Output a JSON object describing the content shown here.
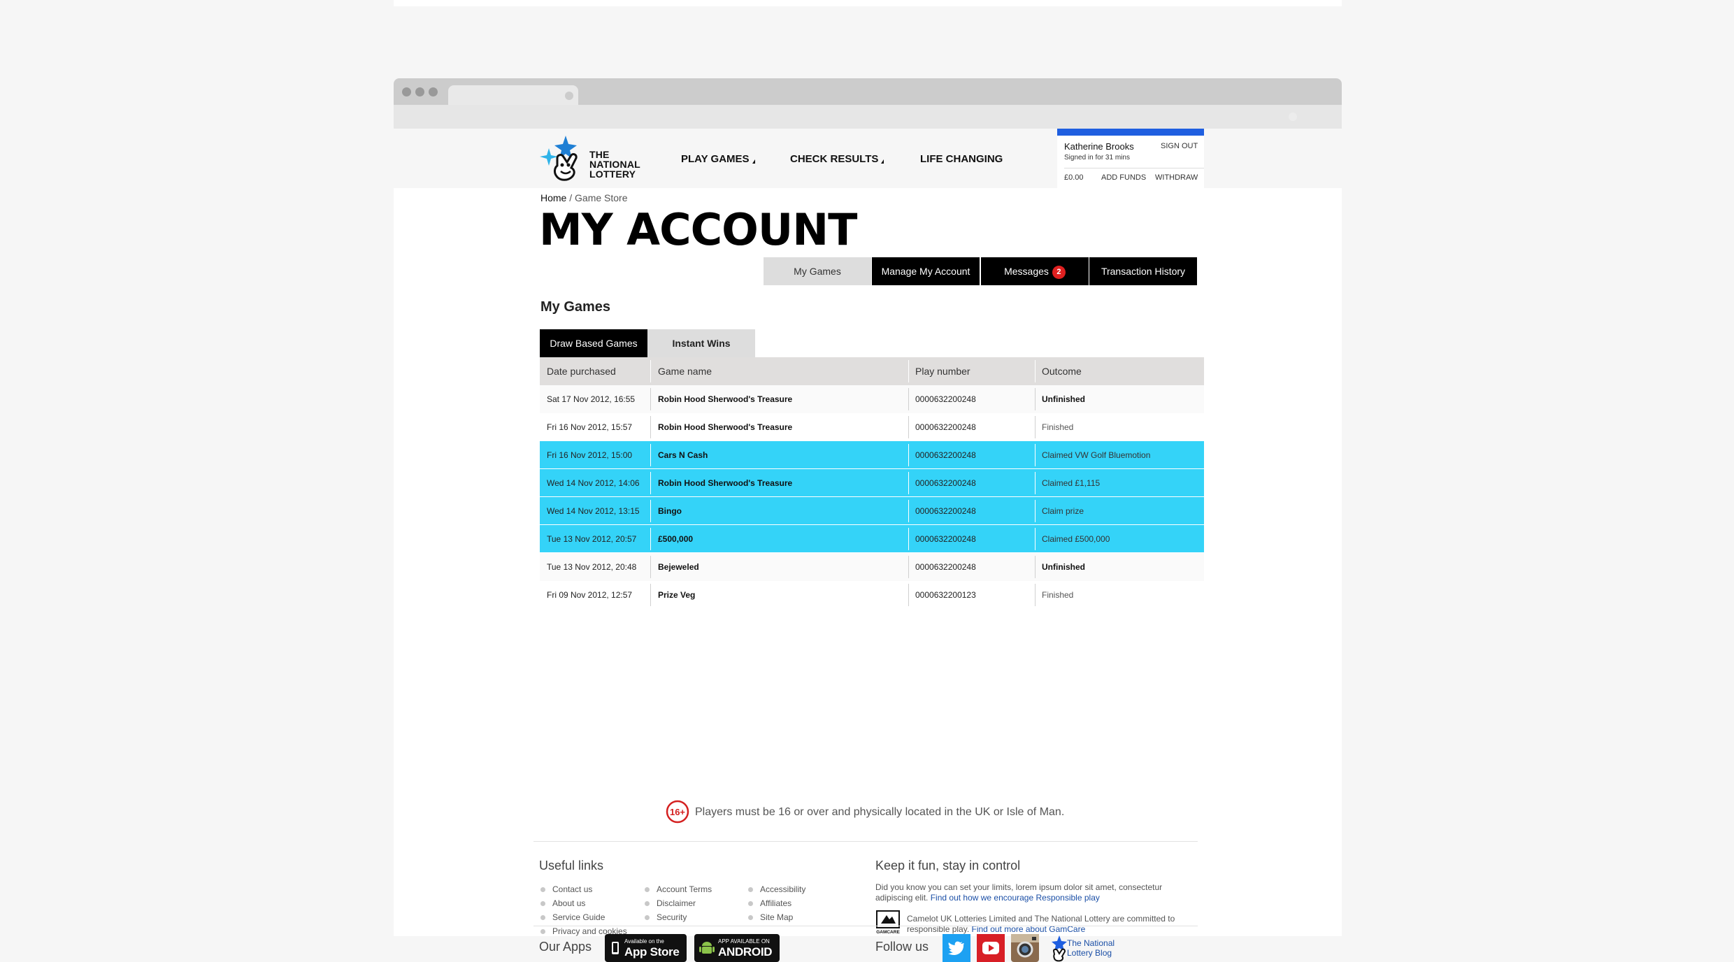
{
  "header": {
    "logo_lines": [
      "THE",
      "NATIONAL",
      "LOTTERY"
    ],
    "nav": [
      {
        "label": "PLAY GAMES",
        "has_caret": true
      },
      {
        "label": "CHECK RESULTS",
        "has_caret": true
      },
      {
        "label": "LIFE CHANGING",
        "has_caret": false
      }
    ],
    "account": {
      "name": "Katherine Brooks",
      "signed_in": "Signed in for 31 mins",
      "sign_out": "SIGN OUT",
      "balance": "£0.00",
      "add_funds": "ADD FUNDS",
      "withdraw": "WITHDRAW",
      "accent_color": "#1f5fe0"
    }
  },
  "breadcrumb": {
    "home": "Home",
    "separator": " / ",
    "current": "Game Store"
  },
  "page_title": "MY ACCOUNT",
  "account_tabs": [
    {
      "label": "My Games",
      "active": true
    },
    {
      "label": "Manage My Account",
      "active": false
    },
    {
      "label": "Messages",
      "active": false,
      "badge": "2"
    },
    {
      "label": "Transaction History",
      "active": false
    }
  ],
  "section_title": "My Games",
  "sub_tabs": [
    {
      "label": "Draw Based Games",
      "active": true
    },
    {
      "label": "Instant Wins",
      "active": false
    }
  ],
  "table": {
    "columns": [
      "Date purchased",
      "Game name",
      "Play number",
      "Outcome"
    ],
    "highlight_color": "#34d3f8",
    "rows": [
      {
        "date": "Sat 17 Nov 2012, 16:55",
        "game": "Robin Hood Sherwood's Treasure",
        "play": "0000632200248",
        "outcome": "Unfinished",
        "outcome_bold": true,
        "highlight": false
      },
      {
        "date": "Fri 16 Nov 2012, 15:57",
        "game": "Robin Hood Sherwood's Treasure",
        "play": "0000632200248",
        "outcome": "Finished",
        "outcome_bold": false,
        "highlight": false
      },
      {
        "date": "Fri 16 Nov 2012, 15:00",
        "game": "Cars N Cash",
        "play": "0000632200248",
        "outcome": "Claimed VW Golf Bluemotion",
        "outcome_bold": false,
        "highlight": true
      },
      {
        "date": "Wed 14 Nov 2012, 14:06",
        "game": "Robin Hood Sherwood's Treasure",
        "play": "0000632200248",
        "outcome": "Claimed £1,115",
        "outcome_bold": false,
        "highlight": true
      },
      {
        "date": "Wed 14 Nov 2012, 13:15",
        "game": "Bingo",
        "play": "0000632200248",
        "outcome": "Claim prize",
        "outcome_bold": false,
        "highlight": true
      },
      {
        "date": "Tue 13 Nov 2012, 20:57",
        "game": "£500,000",
        "play": "0000632200248",
        "outcome": "Claimed £500,000",
        "outcome_bold": false,
        "highlight": true
      },
      {
        "date": "Tue 13 Nov 2012, 20:48",
        "game": "Bejeweled",
        "play": "0000632200248",
        "outcome": "Unfinished",
        "outcome_bold": true,
        "highlight": false
      },
      {
        "date": "Fri 09 Nov 2012, 12:57",
        "game": "Prize Veg",
        "play": "0000632200123",
        "outcome": "Finished",
        "outcome_bold": false,
        "highlight": false
      }
    ]
  },
  "age_notice": {
    "badge": "16+",
    "text": "Players must be 16 or over and physically located in the UK or Isle of Man."
  },
  "footer": {
    "useful_links_title": "Useful links",
    "useful_links": [
      [
        "Contact us",
        "About us",
        "Service Guide",
        "Privacy and cookies"
      ],
      [
        "Account Terms",
        "Disclaimer",
        "Security"
      ],
      [
        "Accessibility",
        "Affiliates",
        "Site Map"
      ]
    ],
    "keep_fun_title": "Keep it fun, stay in control",
    "keep_fun_text": "Did you know you can set your limits, lorem ipsum dolor sit amet, consectetur adipiscing elit.",
    "keep_fun_link": "Find out how we encourage Responsible play",
    "gamcare_label": "GAMCARE",
    "gamcare_text": "Camelot UK Lotteries Limited and The National Lottery are committed to responsible play.",
    "gamcare_link": "Find out more about GamCare",
    "apps_title": "Our Apps",
    "app_store": {
      "small": "Available on the",
      "big": "App Store"
    },
    "android": {
      "small": "APP AVAILABLE ON",
      "big": "ANDROID"
    },
    "follow_title": "Follow us",
    "blog_link": "The National Lottery Blog",
    "social": [
      "twitter-icon",
      "youtube-icon",
      "instagram-icon",
      "lottery-blog-icon"
    ]
  }
}
